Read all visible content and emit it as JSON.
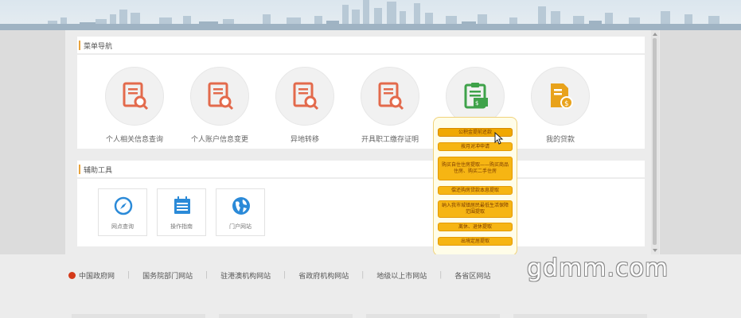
{
  "menu_nav": {
    "title": "菜单导航",
    "items": [
      {
        "label": "个人相关信息查询",
        "icon": "document-search-icon"
      },
      {
        "label": "个人账户信息变更",
        "icon": "document-search-icon"
      },
      {
        "label": "异地转移",
        "icon": "document-search-icon"
      },
      {
        "label": "开具职工缴存证明",
        "icon": "document-search-icon"
      },
      {
        "label": "",
        "icon": "clipboard-money-icon"
      },
      {
        "label": "我的贷款",
        "icon": "loan-document-icon"
      }
    ]
  },
  "aux_tools": {
    "title": "辅助工具",
    "items": [
      {
        "label": "网点查询",
        "icon": "compass-icon"
      },
      {
        "label": "操作指南",
        "icon": "calendar-guide-icon"
      },
      {
        "label": "门户网站",
        "icon": "globe-icon"
      }
    ]
  },
  "popup": {
    "options": [
      "公积金提前还款",
      "按月对冲申请",
      "购买自住住房提取——购买商品住房、购买二手住房",
      "偿还购房贷款本息提取",
      "纳入我市城镇居民最低生活保障范围提取",
      "离休、退休提取",
      "出境定居提取"
    ]
  },
  "footer": {
    "links": [
      "中国政府网",
      "国务院部门网站",
      "驻港澳机构网站",
      "省政府机构网站",
      "地级以上市网站",
      "各省区网站"
    ]
  },
  "watermark": "gdmm.com",
  "colors": {
    "accent_orange": "#e8a33d",
    "icon_red": "#e36a4c",
    "icon_green": "#3fa24a",
    "icon_yellow": "#e8a21b",
    "tool_blue": "#2b8ad8",
    "popup_option": "#f6b513"
  }
}
